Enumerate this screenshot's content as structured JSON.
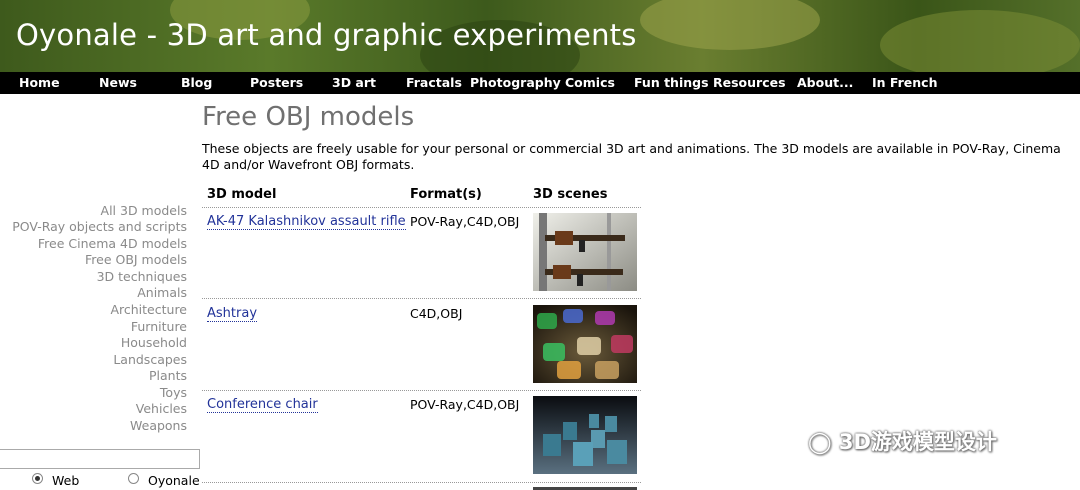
{
  "header": {
    "title": "Oyonale - 3D art and graphic experiments"
  },
  "nav": {
    "items": [
      "Home",
      "News",
      "Blog",
      "Posters",
      "3D art",
      "Fractals",
      "Photography",
      "Comics",
      "Fun things",
      "Resources",
      "About...",
      "In French"
    ]
  },
  "sidebar": {
    "items": [
      "All 3D models",
      "POV-Ray objects and scripts",
      "Free Cinema 4D models",
      "Free OBJ models",
      "3D techniques",
      "Animals",
      "Architecture",
      "Furniture",
      "Household",
      "Landscapes",
      "Plants",
      "Toys",
      "Vehicles",
      "Weapons"
    ]
  },
  "search": {
    "placeholder": "",
    "options": [
      "Web",
      "Oyonale"
    ],
    "selected": "Web"
  },
  "main": {
    "title": "Free OBJ models",
    "intro": "These objects are freely usable for your personal or commercial 3D art and animations. The 3D models are available in POV-Ray, Cinema 4D and/or Wavefront OBJ formats.",
    "columns": [
      "3D model",
      "Format(s)",
      "3D scenes"
    ],
    "rows": [
      {
        "name": "AK-47 Kalashnikov assault rifle",
        "formats": "POV-Ray,C4D,OBJ",
        "thumb": "rifle-render"
      },
      {
        "name": "Ashtray",
        "formats": "C4D,OBJ",
        "thumb": "glass-ashtray-render"
      },
      {
        "name": "Conference chair",
        "formats": "POV-Ray,C4D,OBJ",
        "thumb": "chairs-render"
      }
    ]
  },
  "watermark": {
    "text": "3D游戏模型设计"
  },
  "colors": {
    "nav_bg": "#000000",
    "link": "#223399",
    "sidebar_text": "#8a8a8a",
    "title_gray": "#707070"
  }
}
